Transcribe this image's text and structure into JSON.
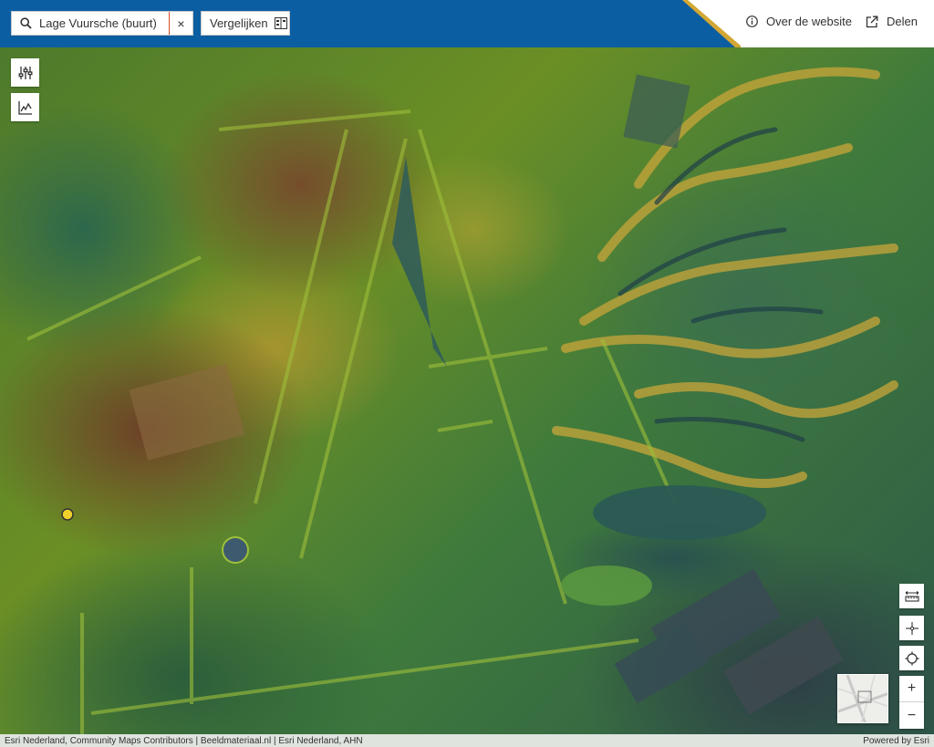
{
  "header": {
    "search": {
      "value": "Lage Vuursche (buurt)",
      "clear_label": "×"
    },
    "compare_label": "Vergelijken",
    "about_label": "Over de website",
    "share_label": "Delen"
  },
  "map": {
    "overview_alt": "Overzichtskaart",
    "zoom_in_label": "+",
    "zoom_out_label": "−"
  },
  "attribution": {
    "sources": "Esri Nederland, Community Maps Contributors | Beeldmateriaal.nl | Esri Nederland, AHN",
    "powered_by": "Powered by Esri"
  },
  "colors": {
    "header_blue": "#0b5ea1",
    "header_gold": "#d3a733",
    "marker_yellow": "#f0d02a"
  },
  "icons": {
    "search": "search-icon",
    "clear": "close-icon",
    "compare": "compare-icon",
    "about": "info-icon",
    "share": "share-icon",
    "layers": "sliders-icon",
    "profile": "elevation-profile-icon",
    "measure": "measure-icon",
    "locate_point": "crosshair-icon",
    "my_location": "locate-icon"
  }
}
